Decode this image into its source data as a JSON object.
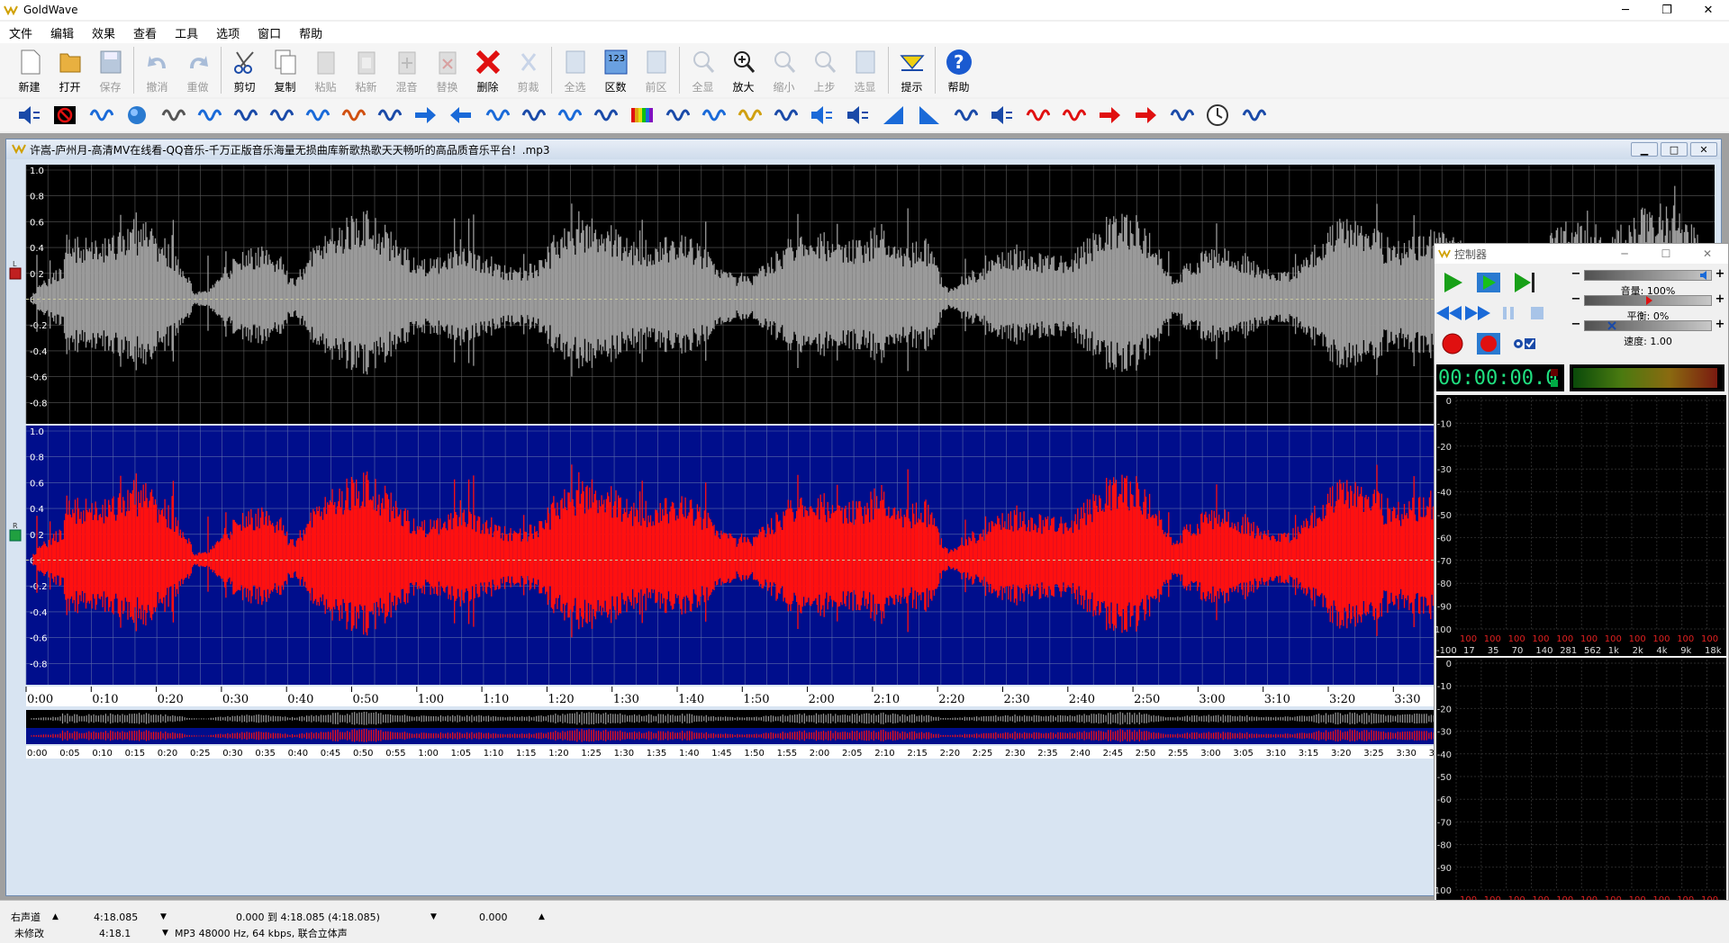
{
  "app": {
    "title": "GoldWave",
    "minimize": "─",
    "maximize": "❐",
    "close": "✕"
  },
  "menu": [
    "文件",
    "编辑",
    "效果",
    "查看",
    "工具",
    "选项",
    "窗口",
    "帮助"
  ],
  "toolbar": {
    "items": [
      {
        "label": "新建",
        "icon": "new-file-icon",
        "enabled": true
      },
      {
        "label": "打开",
        "icon": "open-folder-icon",
        "enabled": true
      },
      {
        "label": "保存",
        "icon": "save-icon",
        "enabled": false
      },
      {
        "label": "撤消",
        "icon": "undo-icon",
        "enabled": false
      },
      {
        "label": "重做",
        "icon": "redo-icon",
        "enabled": false
      },
      {
        "label": "剪切",
        "icon": "scissors-icon",
        "enabled": true
      },
      {
        "label": "复制",
        "icon": "copy-icon",
        "enabled": true
      },
      {
        "label": "粘贴",
        "icon": "paste-icon",
        "enabled": false
      },
      {
        "label": "粘新",
        "icon": "paste-new-icon",
        "enabled": false
      },
      {
        "label": "混音",
        "icon": "mix-icon",
        "enabled": false
      },
      {
        "label": "替换",
        "icon": "replace-icon",
        "enabled": false
      },
      {
        "label": "删除",
        "icon": "delete-icon",
        "enabled": true
      },
      {
        "label": "剪裁",
        "icon": "trim-icon",
        "enabled": false
      },
      {
        "label": "全选",
        "icon": "select-all-icon",
        "enabled": false
      },
      {
        "label": "区数",
        "icon": "region-count-icon",
        "enabled": true
      },
      {
        "label": "前区",
        "icon": "previous-region-icon",
        "enabled": false
      },
      {
        "label": "全显",
        "icon": "show-all-icon",
        "enabled": false
      },
      {
        "label": "放大",
        "icon": "zoom-in-icon",
        "enabled": true
      },
      {
        "label": "缩小",
        "icon": "zoom-out-icon",
        "enabled": false
      },
      {
        "label": "上步",
        "icon": "previous-zoom-icon",
        "enabled": false
      },
      {
        "label": "选显",
        "icon": "zoom-selection-icon",
        "enabled": false
      },
      {
        "label": "提示",
        "icon": "cue-icon",
        "enabled": true
      },
      {
        "label": "帮助",
        "icon": "help-icon",
        "enabled": true
      }
    ]
  },
  "effects_toolbar": [
    "volume-icon",
    "mute-icon",
    "maximize-volume-icon",
    "echo-icon",
    "noise-icon",
    "doppler-icon",
    "pitch-icon",
    "reverse-icon",
    "mechanize-icon",
    "equalizer-icon",
    "filter-icon",
    "forward-icon",
    "back-icon",
    "offset-icon",
    "mixer-icon",
    "compressor-icon",
    "spectrum-filter-icon",
    "spectrum-icon",
    "stereo-icon",
    "insert-silence-icon",
    "cue-palette-icon",
    "marker-start-icon",
    "speaker-icon",
    "speaker-level-icon",
    "fade-in-icon",
    "fade-out-icon",
    "alert-icon",
    "speaker-marker-icon",
    "eraser-icon",
    "noise-reduction-icon",
    "left-arrow-icon",
    "right-arrow-icon",
    "channel-icon",
    "clock-icon",
    "chat-icon"
  ],
  "document": {
    "title": "许嵩-庐州月-高清MV在线看-QQ音乐-千万正版音乐海量无损曲库新歌热歌天天畅听的高品质音乐平台！.mp3",
    "left_channel_label": "L",
    "right_channel_label": "R",
    "y_ticks": [
      "1.0",
      "0.8",
      "0.6",
      "0.4",
      "0.2",
      "0.0",
      "-0.2",
      "-0.4",
      "-0.6",
      "-0.8"
    ],
    "time_ticks": [
      "0:00",
      "0:10",
      "0:20",
      "0:30",
      "0:40",
      "0:50",
      "1:00",
      "1:10",
      "1:20",
      "1:30",
      "1:40",
      "1:50",
      "2:00",
      "2:10",
      "2:20",
      "2:30",
      "2:40",
      "2:50",
      "3:00",
      "3:10",
      "3:20",
      "3:30"
    ],
    "overview_ticks": [
      "0:00",
      "0:05",
      "0:10",
      "0:15",
      "0:20",
      "0:25",
      "0:30",
      "0:35",
      "0:40",
      "0:45",
      "0:50",
      "0:55",
      "1:00",
      "1:05",
      "1:10",
      "1:15",
      "1:20",
      "1:25",
      "1:30",
      "1:35",
      "1:40",
      "1:45",
      "1:50",
      "1:55",
      "2:00",
      "2:05",
      "2:10",
      "2:15",
      "2:20",
      "2:25",
      "2:30",
      "2:35",
      "2:40",
      "2:45",
      "2:50",
      "2:55",
      "3:00",
      "3:05",
      "3:10",
      "3:15",
      "3:20",
      "3:25",
      "3:30",
      "3:"
    ],
    "colors": {
      "left_bg": "#000000",
      "left_wave": "#9a9a9a",
      "right_bg": "#000e8c",
      "right_wave": "#ff1010",
      "grid": "#5a5a5a"
    }
  },
  "controller": {
    "title": "控制器",
    "volume_label": "音量: 100%",
    "balance_label": "平衡: 0%",
    "speed_label": "速度: 1.00",
    "time": "00:00:00.0",
    "spectrum_y": [
      "0",
      "-10",
      "-20",
      "-30",
      "-40",
      "-50",
      "-60",
      "-70",
      "-80",
      "-90",
      "-100"
    ],
    "spectrum_x": [
      "17",
      "35",
      "70",
      "140",
      "281",
      "562",
      "1k",
      "2k",
      "4k",
      "9k",
      "18k"
    ],
    "spectrum_levels": [
      "100",
      "100",
      "100",
      "100",
      "100",
      "100",
      "100",
      "100",
      "100",
      "100",
      "100"
    ]
  },
  "status": {
    "channel": "右声道",
    "duration": "4:18.085",
    "selection": "0.000 到 4:18.085 (4:18.085)",
    "position": "0.000",
    "modified": "未修改",
    "length2": "4:18.1",
    "format": "MP3 48000 Hz, 64 kbps, 联合立体声"
  }
}
